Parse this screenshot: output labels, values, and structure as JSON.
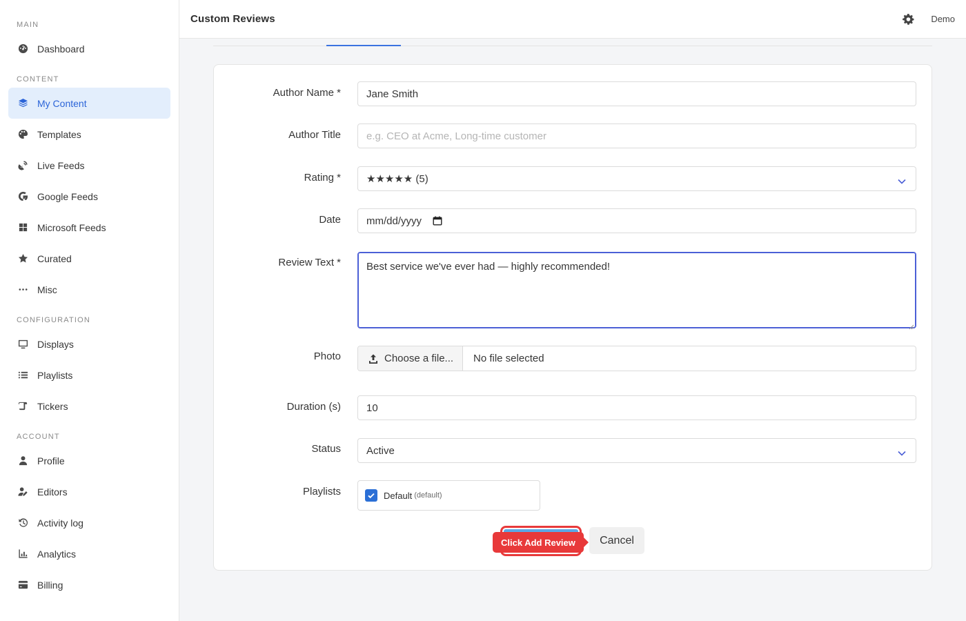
{
  "sidebar": {
    "sections": {
      "main": "MAIN",
      "content": "CONTENT",
      "configuration": "CONFIGURATION",
      "account": "ACCOUNT"
    },
    "items": {
      "dashboard": "Dashboard",
      "my_content": "My Content",
      "templates": "Templates",
      "live_feeds": "Live Feeds",
      "google_feeds": "Google Feeds",
      "microsoft_feeds": "Microsoft Feeds",
      "curated": "Curated",
      "misc": "Misc",
      "displays": "Displays",
      "playlists": "Playlists",
      "tickers": "Tickers",
      "profile": "Profile",
      "editors": "Editors",
      "activity_log": "Activity log",
      "analytics": "Analytics",
      "billing": "Billing"
    },
    "active_item": "my_content"
  },
  "header": {
    "title": "Custom Reviews",
    "user": "Demo"
  },
  "form": {
    "author_name": {
      "label": "Author Name *",
      "value": "Jane Smith"
    },
    "author_title": {
      "label": "Author Title",
      "placeholder": "e.g. CEO at Acme, Long-time customer"
    },
    "rating": {
      "label": "Rating *",
      "value": "★★★★★ (5)"
    },
    "date": {
      "label": "Date",
      "value": "mm/dd/yyyy"
    },
    "review_text": {
      "label": "Review Text *",
      "value": "Best service we've ever had — highly recommended!"
    },
    "photo": {
      "label": "Photo",
      "button": "Choose a file...",
      "file_name": "No file selected"
    },
    "duration": {
      "label": "Duration (s)",
      "value": "10"
    },
    "status": {
      "label": "Status",
      "value": "Active"
    },
    "playlists": {
      "label": "Playlists",
      "item_name": "Default",
      "item_tag": "(default)",
      "checked": true
    }
  },
  "actions": {
    "tooltip": "Click Add Review",
    "cancel": "Cancel"
  },
  "colors": {
    "accent": "#2b64d8",
    "active_bg": "#e3eefc",
    "highlight": "#e8393a",
    "focus_border": "#4b5fd6",
    "checkbox": "#2b6fd6"
  }
}
